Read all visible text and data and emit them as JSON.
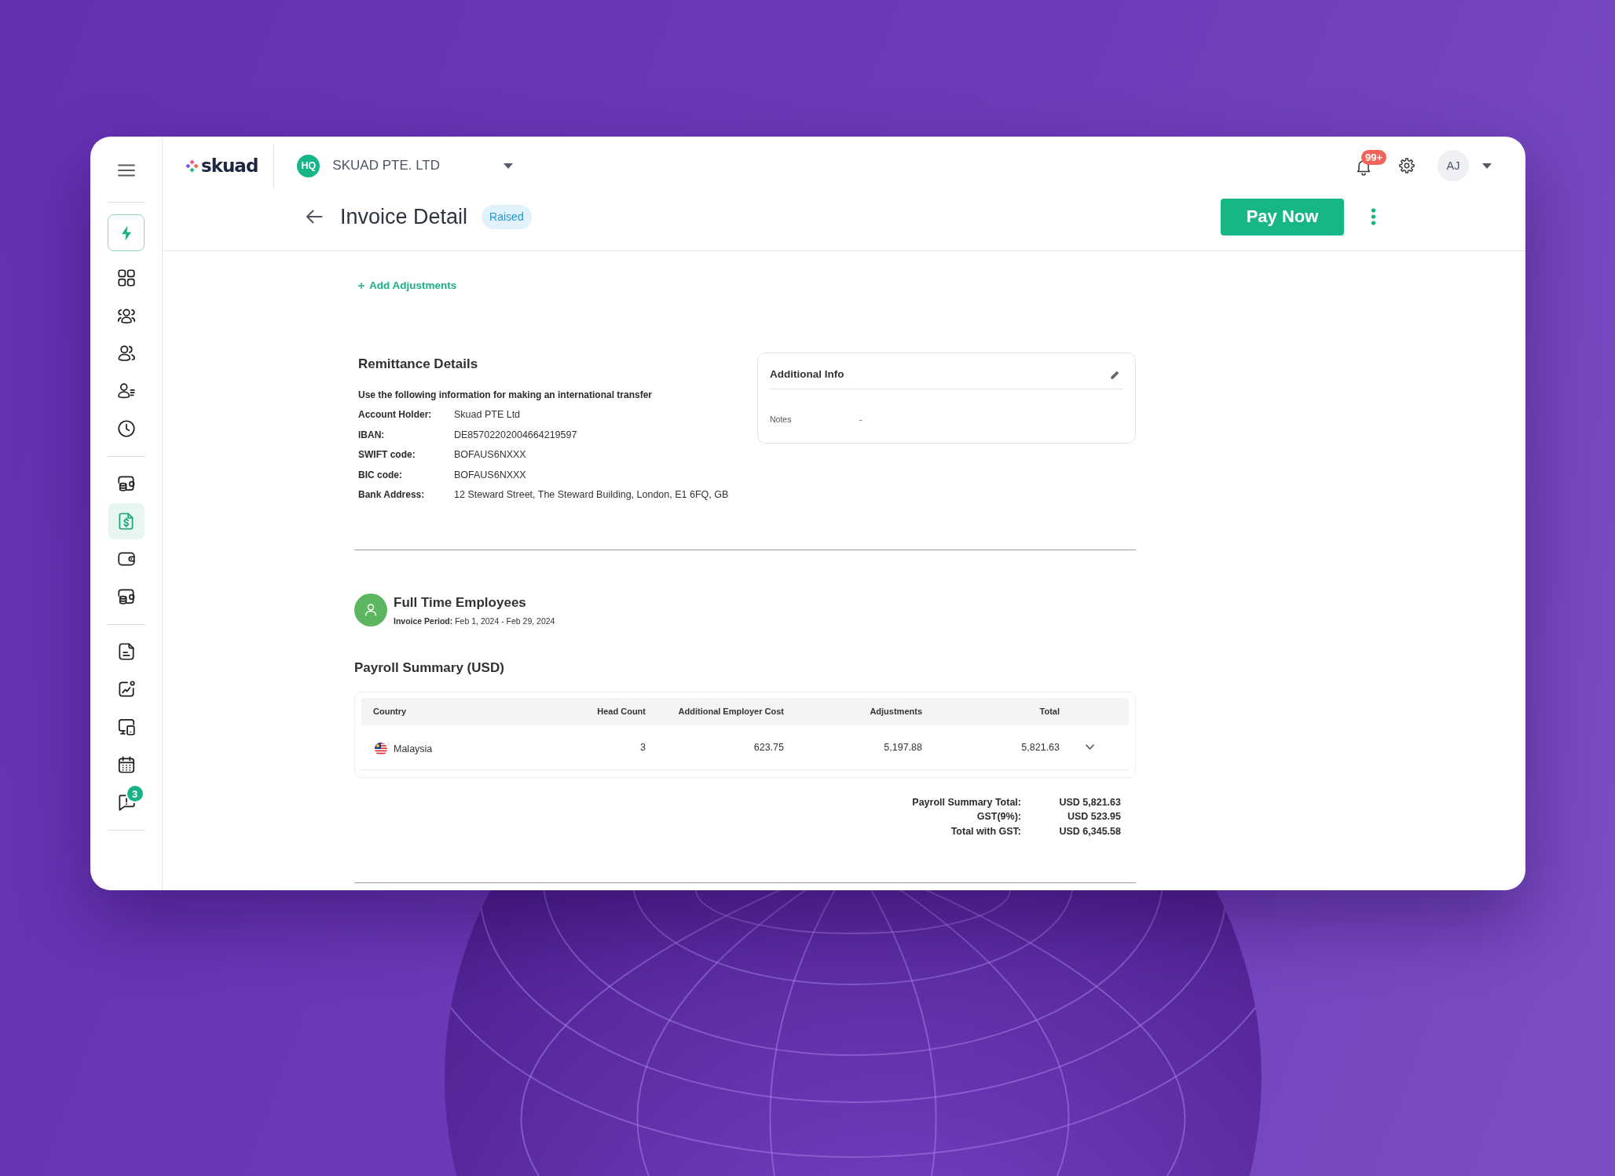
{
  "sidebar": {
    "groups": [
      {
        "items": [
          {
            "kind": "action",
            "selected": false
          },
          {
            "kind": "link",
            "selected": false
          },
          {
            "kind": "link",
            "selected": false
          },
          {
            "kind": "link",
            "selected": false
          },
          {
            "kind": "link",
            "selected": false
          },
          {
            "kind": "link",
            "selected": false
          }
        ]
      },
      {
        "items": [
          {
            "kind": "link",
            "selected": false
          },
          {
            "kind": "link",
            "selected": true
          },
          {
            "kind": "link",
            "selected": false
          },
          {
            "kind": "link",
            "selected": false
          }
        ]
      },
      {
        "items": [
          {
            "kind": "link",
            "selected": false
          },
          {
            "kind": "link",
            "selected": false
          },
          {
            "kind": "link",
            "selected": false
          },
          {
            "kind": "link",
            "selected": false
          },
          {
            "kind": "link",
            "selected": false,
            "badge": "3"
          }
        ]
      }
    ]
  },
  "header": {
    "logo": "skuad",
    "company": {
      "initials": "HQ",
      "name": "SKUAD PTE. LTD"
    },
    "notification_badge": "99+",
    "user_initials": "AJ"
  },
  "page": {
    "title": "Invoice Detail",
    "status": "Raised",
    "primary_action": "Pay Now"
  },
  "add_adjustments": "Add Adjustments",
  "remittance": {
    "title": "Remittance Details",
    "intro": "Use the following information for making an international transfer",
    "fields": [
      {
        "label": "Account Holder:",
        "value": "Skuad PTE Ltd"
      },
      {
        "label": "IBAN:",
        "value": "DE85702202004664219597"
      },
      {
        "label": "SWIFT code:",
        "value": "BOFAUS6NXXX"
      },
      {
        "label": "BIC code:",
        "value": "BOFAUS6NXXX"
      },
      {
        "label": "Bank Address:",
        "value": "12 Steward Street, The Steward Building, London, E1 6FQ, GB"
      }
    ]
  },
  "additional_info": {
    "title": "Additional Info",
    "fields": [
      {
        "label": "Notes",
        "value": "-"
      }
    ]
  },
  "employees": {
    "title": "Full Time Employees",
    "period": "**Invoice Period:** Feb 1, 2024 - Feb 29, 2024"
  },
  "payroll": {
    "title": "Payroll Summary (USD)",
    "columns": [
      "Country",
      "Head Count",
      "Additional Employer Cost",
      "Adjustments",
      "Total"
    ],
    "rows": [
      {
        "cells": [
          "Malaysia",
          "3",
          "623.75",
          "5,197.88",
          "5,821.63"
        ],
        "expanded": false
      }
    ],
    "totals": [
      {
        "label": "Payroll Summary Total:",
        "value": "USD 5,821.63"
      },
      {
        "label": "GST(9%):",
        "value": "USD 523.95"
      },
      {
        "label": "Total with GST:",
        "value": "USD 6,345.58"
      }
    ]
  }
}
